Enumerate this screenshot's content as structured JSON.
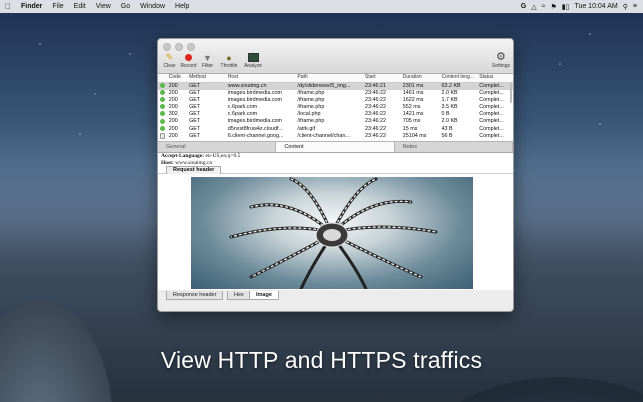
{
  "menubar": {
    "app": "Finder",
    "items": [
      "File",
      "Edit",
      "View",
      "Go",
      "Window",
      "Help"
    ],
    "clock": "Tue 10:04 AM"
  },
  "toolbar": {
    "clear": "Clear",
    "record": "Record",
    "filter": "Filter",
    "throttle": "Throttle",
    "analyze": "Analyze",
    "settings": "Settings"
  },
  "table": {
    "headers": [
      "Code",
      "Method",
      "Host",
      "Path",
      "Start",
      "Duration",
      "Content leng...",
      "Status"
    ],
    "rows": [
      {
        "code": "200",
        "method": "GET",
        "host": "www.sinaimg.cn",
        "path": "/dy/slidenews/5_img...",
        "start": "23:46:21",
        "duration": "2301 ms",
        "length": "63.2 KB",
        "status": "Complet..."
      },
      {
        "code": "200",
        "method": "GET",
        "host": "images.birdmedia.com",
        "path": "/iframe.php",
        "start": "23:46:22",
        "duration": "1461 ms",
        "length": "2.0 KB",
        "status": "Complet..."
      },
      {
        "code": "200",
        "method": "GET",
        "host": "images.birdmedia.com",
        "path": "/iframe.php",
        "start": "23:46:22",
        "duration": "1622 ms",
        "length": "1.7 KB",
        "status": "Complet..."
      },
      {
        "code": "200",
        "method": "GET",
        "host": "c.6park.com",
        "path": "/iframe.php",
        "start": "23:46:22",
        "duration": "552 ms",
        "length": "3.5 KB",
        "status": "Complet..."
      },
      {
        "code": "302",
        "method": "GET",
        "host": "c.6park.com",
        "path": "/local.php",
        "start": "23:46:22",
        "duration": "1421 ms",
        "length": "0 B",
        "status": "Complet..."
      },
      {
        "code": "200",
        "method": "GET",
        "host": "images.birdmedia.com",
        "path": "/iframe.php",
        "start": "23:46:22",
        "duration": "705 ms",
        "length": "2.0 KB",
        "status": "Complet..."
      },
      {
        "code": "200",
        "method": "GET",
        "host": "d5nxst8fruw4z.cloudf...",
        "path": "/atrk.gif",
        "start": "23:46:22",
        "duration": "15 ms",
        "length": "43 B",
        "status": "Complet..."
      },
      {
        "code": "200",
        "method": "GET",
        "host": "6.client-channel.goog...",
        "path": "/client-channel/chan...",
        "start": "23:46:22",
        "duration": "25104 ms",
        "length": "56 B",
        "status": "Complet..."
      }
    ]
  },
  "tabs": [
    "General",
    "Content",
    "Notes"
  ],
  "request": {
    "line1_key": "Accept-Language:",
    "line1_val": "en-US,en;q=0.5",
    "line2_key": "Host:",
    "line2_val": "www.sinaimg.cn",
    "subtab": "Request header"
  },
  "bottom_tabs": [
    "Response header",
    "Hex",
    "Image"
  ],
  "caption": "View HTTP and HTTPS traffics"
}
